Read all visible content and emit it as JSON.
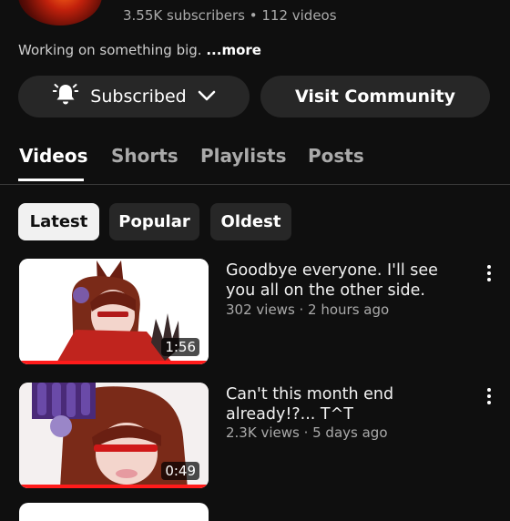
{
  "channel": {
    "stats": "3.55K subscribers • 112 videos",
    "description": "Working on something big.",
    "more_label": "...more"
  },
  "actions": {
    "subscribed_label": "Subscribed",
    "visit_label": "Visit Community"
  },
  "tabs": [
    {
      "label": "Videos",
      "active": true
    },
    {
      "label": "Shorts",
      "active": false
    },
    {
      "label": "Playlists",
      "active": false
    },
    {
      "label": "Posts",
      "active": false
    }
  ],
  "chips": [
    {
      "label": "Latest",
      "selected": true
    },
    {
      "label": "Popular",
      "selected": false
    },
    {
      "label": "Oldest",
      "selected": false
    }
  ],
  "videos": [
    {
      "title": "Goodbye everyone. I'll see you all on the other side.",
      "meta": "302 views · 2 hours ago",
      "duration": "1:56",
      "watched_fraction": 1.0
    },
    {
      "title": "Can't this month end already!?... T^T",
      "meta": "2.3K views · 5 days ago",
      "duration": "0:49",
      "watched_fraction": 1.0
    }
  ],
  "icons": {
    "bell": "bell-icon",
    "chevron": "chevron-down-icon",
    "more": "more-vert-icon"
  }
}
